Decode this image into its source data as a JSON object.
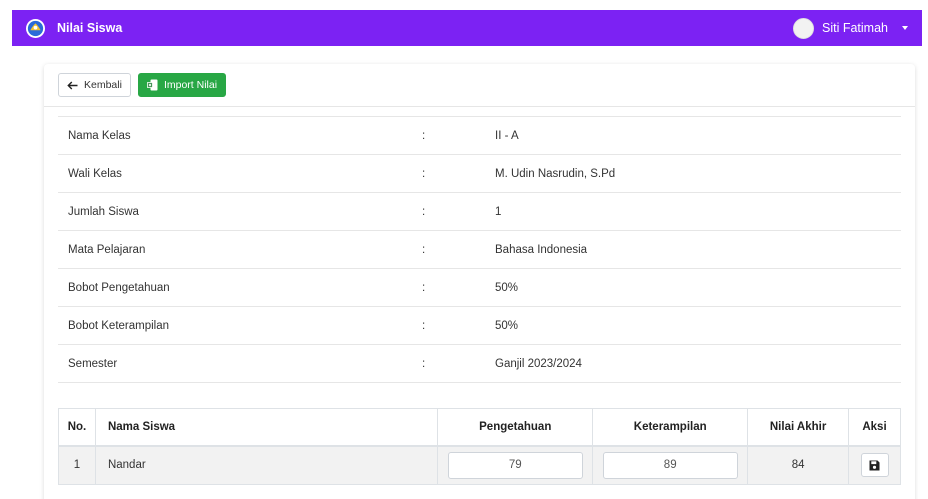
{
  "navbar": {
    "logo_icon": "tut-wuri-handayani-logo",
    "title": "Nilai Siswa",
    "user_name": "Siti Fatimah",
    "color": "#7c22f3"
  },
  "toolbar": {
    "back_label": "Kembali",
    "import_label": "Import Nilai",
    "import_color": "#28a745"
  },
  "info": [
    {
      "label": "Nama Kelas",
      "sep": ":",
      "value": "II - A"
    },
    {
      "label": "Wali Kelas",
      "sep": ":",
      "value": "M. Udin Nasrudin, S.Pd"
    },
    {
      "label": "Jumlah Siswa",
      "sep": ":",
      "value": "1"
    },
    {
      "label": "Mata Pelajaran",
      "sep": ":",
      "value": "Bahasa Indonesia"
    },
    {
      "label": "Bobot Pengetahuan",
      "sep": ":",
      "value": "50%"
    },
    {
      "label": "Bobot Keterampilan",
      "sep": ":",
      "value": "50%"
    },
    {
      "label": "Semester",
      "sep": ":",
      "value": "Ganjil 2023/2024"
    }
  ],
  "table": {
    "headers": [
      "No.",
      "Nama Siswa",
      "Pengetahuan",
      "Keterampilan",
      "Nilai Akhir",
      "Aksi"
    ],
    "rows": [
      {
        "no": "1",
        "name": "Nandar",
        "pengetahuan": "79",
        "keterampilan": "89",
        "nilai_akhir": "84",
        "action_icon": "save-icon"
      }
    ]
  }
}
